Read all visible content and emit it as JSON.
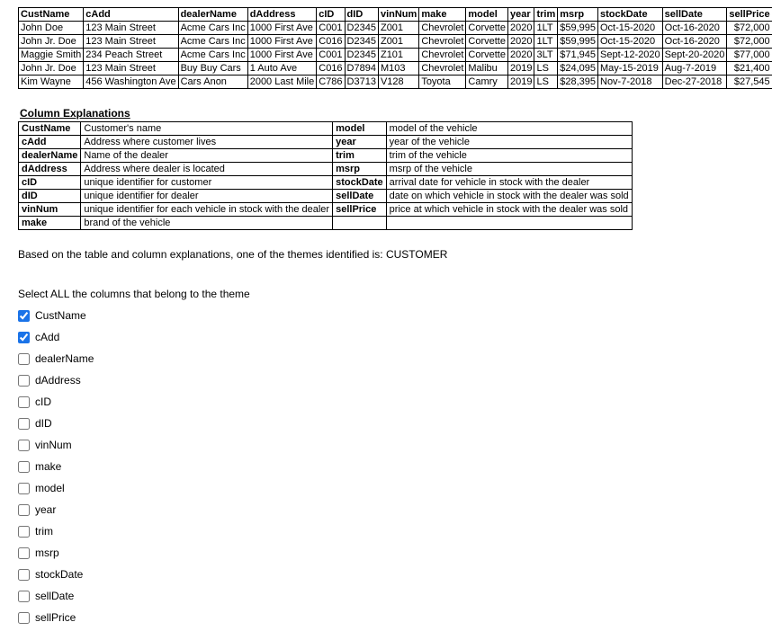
{
  "dataTable": {
    "headers": [
      "CustName",
      "cAdd",
      "dealerName",
      "dAddress",
      "cID",
      "dID",
      "vinNum",
      "make",
      "model",
      "year",
      "trim",
      "msrp",
      "stockDate",
      "sellDate",
      "sellPrice"
    ],
    "rows": [
      [
        "John Doe",
        "123 Main Street",
        "Acme Cars Inc",
        "1000 First Ave",
        "C001",
        "D2345",
        "Z001",
        "Chevrolet",
        "Corvette",
        "2020",
        "1LT",
        "$59,995",
        "Oct-15-2020",
        "Oct-16-2020",
        "$72,000"
      ],
      [
        "John Jr. Doe",
        "123 Main Street",
        "Acme Cars Inc",
        "1000 First Ave",
        "C016",
        "D2345",
        "Z001",
        "Chevrolet",
        "Corvette",
        "2020",
        "1LT",
        "$59,995",
        "Oct-15-2020",
        "Oct-16-2020",
        "$72,000"
      ],
      [
        "Maggie Smith",
        "234 Peach Street",
        "Acme Cars Inc",
        "1000 First Ave",
        "C001",
        "D2345",
        "Z101",
        "Chevrolet",
        "Corvette",
        "2020",
        "3LT",
        "$71,945",
        "Sept-12-2020",
        "Sept-20-2020",
        "$77,000"
      ],
      [
        "John Jr. Doe",
        "123 Main Street",
        "Buy Buy Cars",
        "1 Auto Ave",
        "C016",
        "D7894",
        "M103",
        "Chevrolet",
        "Malibu",
        "2019",
        "LS",
        "$24,095",
        "May-15-2019",
        "Aug-7-2019",
        "$21,400"
      ],
      [
        "Kim Wayne",
        "456 Washington Ave",
        "Cars Anon",
        "2000 Last Mile",
        "C786",
        "D3713",
        "V128",
        "Toyota",
        "Camry",
        "2019",
        "LS",
        "$28,395",
        "Nov-7-2018",
        "Dec-27-2018",
        "$27,545"
      ]
    ]
  },
  "explanations": {
    "title": "Column Explanations",
    "left": [
      {
        "key": "CustName",
        "val": "Customer's name"
      },
      {
        "key": "cAdd",
        "val": "Address where customer lives"
      },
      {
        "key": "dealerName",
        "val": "Name of the dealer"
      },
      {
        "key": "dAddress",
        "val": "Address where dealer is located"
      },
      {
        "key": "cID",
        "val": "unique identifier for customer"
      },
      {
        "key": "dID",
        "val": "unique identifier for dealer"
      },
      {
        "key": "vinNum",
        "val": "unique identifier for each vehicle in stock with the dealer"
      },
      {
        "key": "make",
        "val": "brand of the vehicle"
      }
    ],
    "right": [
      {
        "key": "model",
        "val": "model of the vehicle"
      },
      {
        "key": "year",
        "val": "year of the vehicle"
      },
      {
        "key": "trim",
        "val": "trim of the vehicle"
      },
      {
        "key": "msrp",
        "val": "msrp of the vehicle"
      },
      {
        "key": "stockDate",
        "val": "arrival date for vehicle in stock with the dealer"
      },
      {
        "key": "sellDate",
        "val": "date on which vehicle in stock with the dealer was sold"
      },
      {
        "key": "sellPrice",
        "val": "price at which vehicle in stock with the dealer was sold"
      },
      {
        "key": "",
        "val": ""
      }
    ]
  },
  "prompt": "Based on the table and column explanations, one of the themes identified is:  CUSTOMER",
  "question": "Select ALL the columns that belong to  the theme",
  "options": [
    {
      "label": "CustName",
      "checked": true
    },
    {
      "label": "cAdd",
      "checked": true
    },
    {
      "label": "dealerName",
      "checked": false
    },
    {
      "label": "dAddress",
      "checked": false
    },
    {
      "label": "cID",
      "checked": false
    },
    {
      "label": "dID",
      "checked": false
    },
    {
      "label": "vinNum",
      "checked": false
    },
    {
      "label": "make",
      "checked": false
    },
    {
      "label": "model",
      "checked": false
    },
    {
      "label": "year",
      "checked": false
    },
    {
      "label": "trim",
      "checked": false
    },
    {
      "label": "msrp",
      "checked": false
    },
    {
      "label": "stockDate",
      "checked": false
    },
    {
      "label": "sellDate",
      "checked": false
    },
    {
      "label": "sellPrice",
      "checked": false
    }
  ]
}
